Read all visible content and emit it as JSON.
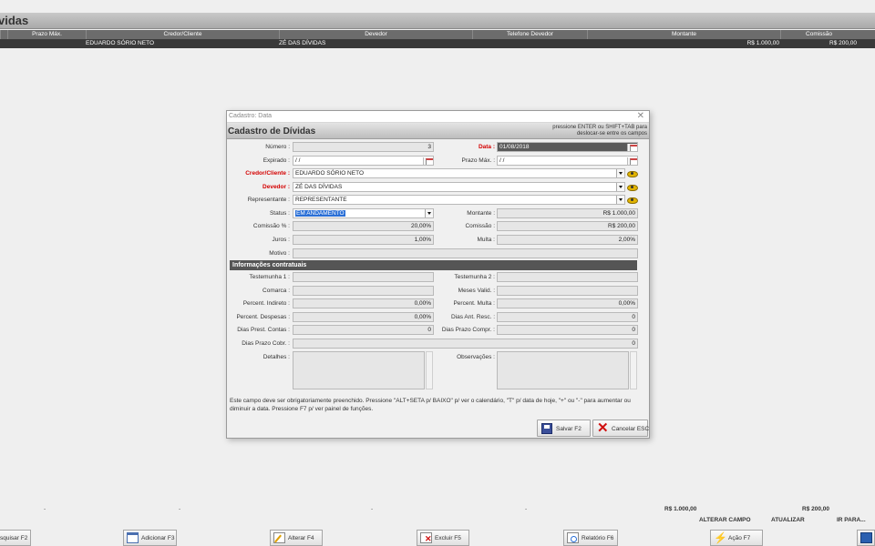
{
  "window": {
    "title": "vidas"
  },
  "grid": {
    "columns": [
      "Prazo Máx.",
      "Credor/Cliente",
      "Devedor",
      "Telefone Devedor",
      "Montante",
      "Comissão"
    ],
    "rows": [
      {
        "credor": "EDUARDO SÓRIO NETO",
        "devedor": "ZÉ DAS DÍVIDAS",
        "montante": "R$ 1.000,00",
        "comissao": "R$ 200,00"
      }
    ]
  },
  "dialog": {
    "window_title": "Cadastro: Data",
    "close_glyph": "✕",
    "heading": "Cadastro de Dívidas",
    "hint": "pressione ENTER ou SHIFT+TAB para deslocar-se entre os campos",
    "fields": {
      "numero": {
        "label": "Número :",
        "value": "3"
      },
      "data": {
        "label": "Data :",
        "value": "01/08/2018"
      },
      "expirado": {
        "label": "Expirado :",
        "value": " / /"
      },
      "prazo_max": {
        "label": "Prazo Máx. :",
        "value": " / /"
      },
      "credor": {
        "label": "Credor/Cliente :",
        "value": "EDUARDO SÓRIO NETO"
      },
      "devedor": {
        "label": "Devedor :",
        "value": "ZÉ DAS DÍVIDAS"
      },
      "representante": {
        "label": "Representante :",
        "value": "REPRESENTANTE"
      },
      "status": {
        "label": "Status :",
        "value": "EM ANDAMENTO"
      },
      "montante": {
        "label": "Montante :",
        "value": "R$ 1.000,00"
      },
      "comissao_pct": {
        "label": "Comissão % :",
        "value": "20,00%"
      },
      "comissao": {
        "label": "Comissão :",
        "value": "R$ 200,00"
      },
      "juros": {
        "label": "Juros :",
        "value": "1,00%"
      },
      "multa": {
        "label": "Multa :",
        "value": "2,00%"
      },
      "motivo": {
        "label": "Motivo :",
        "value": ""
      }
    },
    "section_title": "Informações contratuais",
    "contract": {
      "testemunha1": {
        "label": "Testemunha 1 :",
        "value": ""
      },
      "testemunha2": {
        "label": "Testemunha 2 :",
        "value": ""
      },
      "comarca": {
        "label": "Comarca :",
        "value": ""
      },
      "meses_valid": {
        "label": "Meses Valid. :",
        "value": ""
      },
      "perc_indireto": {
        "label": "Percent. Indireto :",
        "value": "0,00%"
      },
      "perc_multa": {
        "label": "Percent. Multa :",
        "value": "0,00%"
      },
      "perc_despesas": {
        "label": "Percent. Despesas :",
        "value": "0,00%"
      },
      "dias_ant_resc": {
        "label": "Dias Ant. Resc. :",
        "value": "0"
      },
      "dias_prest_contas": {
        "label": "Dias Prest. Contas :",
        "value": "0"
      },
      "dias_prazo_compr": {
        "label": "Dias Prazo Compr. :",
        "value": "0"
      },
      "dias_prazo_cobr": {
        "label": "Dias Prazo Cobr. :",
        "value": "0"
      },
      "detalhes": {
        "label": "Detalhes :"
      },
      "observacoes": {
        "label": "Observações :"
      }
    },
    "help_text": "Este campo deve ser obrigatoriamente preenchido. Pressione \"ALT+SETA p/ BAIXO\" p/ ver o calendário, \"T\" p/ data de hoje, \"+\" ou \"-\" para aumentar ou diminuir a data. Pressione F7 p/ ver painel de funções.",
    "buttons": {
      "save": "Salvar F2",
      "cancel": "Cancelar ESC"
    }
  },
  "footer": {
    "dash": "-",
    "total_montante": "R$ 1.000,00",
    "total_comissao": "R$ 200,00",
    "links": {
      "alterar": "ALTERAR CAMPO",
      "atualizar": "ATUALIZAR",
      "ir_para": "IR PARA..."
    },
    "buttons": {
      "pesquisar": "squisar F2",
      "adicionar": "Adicionar F3",
      "alterar": "Alterar F4",
      "excluir": "Excluir F5",
      "relatorio": "Relatório F6",
      "acao": "Ação F7"
    }
  }
}
